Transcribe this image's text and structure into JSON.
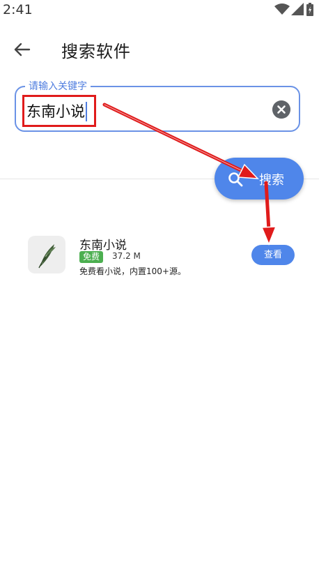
{
  "status_bar": {
    "time": "2:41"
  },
  "header": {
    "title": "搜索软件"
  },
  "search": {
    "label": "请输入关键字",
    "value": "东南小说"
  },
  "search_button": {
    "label": "搜索"
  },
  "results": [
    {
      "name": "东南小说",
      "badge": "免费",
      "size": "37.2 M",
      "description": "免费看小说，内置100+源。",
      "action": "查看"
    }
  ],
  "colors": {
    "accent": "#4f86ea",
    "field_border": "#6a92e6",
    "badge_green": "#4caf50",
    "annotation_red": "#e01b1b"
  },
  "icons": [
    "wifi-icon",
    "signal-icon",
    "battery-icon",
    "back-arrow-icon",
    "clear-icon",
    "search-icon",
    "feather-icon",
    "annotation-arrow"
  ]
}
